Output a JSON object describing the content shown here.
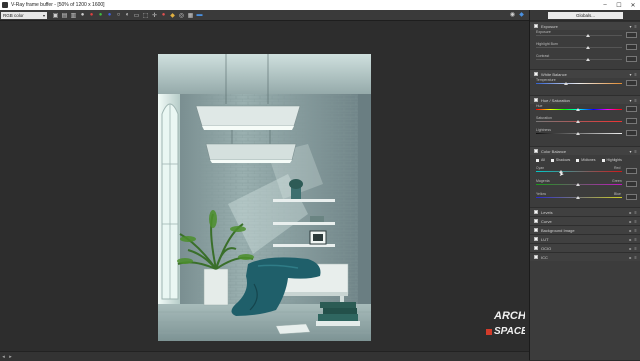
{
  "window": {
    "title": "V-Ray frame buffer - [50% of 1200 x 1600]",
    "controls": [
      "minimize-icon",
      "maximize-icon",
      "close-icon"
    ]
  },
  "toolbar": {
    "channel_select": "RGB color",
    "icons": [
      "save-icon",
      "folder-icon",
      "copy-icon",
      "circle-icon",
      "red-channel-icon",
      "green-channel-icon",
      "blue-channel-icon",
      "alpha-icon",
      "mono-icon",
      "clear-icon",
      "region-icon",
      "track-mouse-icon",
      "stop-icon",
      "render-icon",
      "lens-icon",
      "compare-icon",
      "history-icon"
    ],
    "right_icons": [
      "eye-icon",
      "layers-icon"
    ]
  },
  "panel": {
    "globals_label": "Globals...",
    "exposure": {
      "title": "Exposure",
      "rows": [
        {
          "label": "Exposure",
          "value": 0.55
        },
        {
          "label": "Highlight Burn",
          "value": 0.55
        },
        {
          "label": "Contrast",
          "value": 0.55
        }
      ]
    },
    "white_balance": {
      "title": "White Balance",
      "rows": [
        {
          "label": "Temperature",
          "value": 0.35
        }
      ]
    },
    "hue_saturation": {
      "title": "Hue / Saturation",
      "rows": [
        {
          "label": "Hue",
          "value": 0.5
        },
        {
          "label": "Saturation",
          "value": 0.5
        },
        {
          "label": "Lightness",
          "value": 0.5
        }
      ]
    },
    "color_balance": {
      "title": "Color Balance",
      "modes": [
        "All",
        "Shadows",
        "Midtones",
        "Highlights"
      ],
      "rows": [
        {
          "label": "Cyan",
          "right": "Red",
          "value": 0.3
        },
        {
          "label": "Magenta",
          "right": "Green",
          "value": 0.5
        },
        {
          "label": "Yellow",
          "right": "Blue",
          "value": 0.5
        }
      ]
    },
    "list": [
      "Levels",
      "Curve",
      "Background Image",
      "LUT",
      "OCIO",
      "ICC"
    ]
  },
  "colors": {
    "accent": "#2a79c4",
    "logo_red": "#d23b2a"
  },
  "render": {
    "watermark": "ARCH SPACE"
  }
}
